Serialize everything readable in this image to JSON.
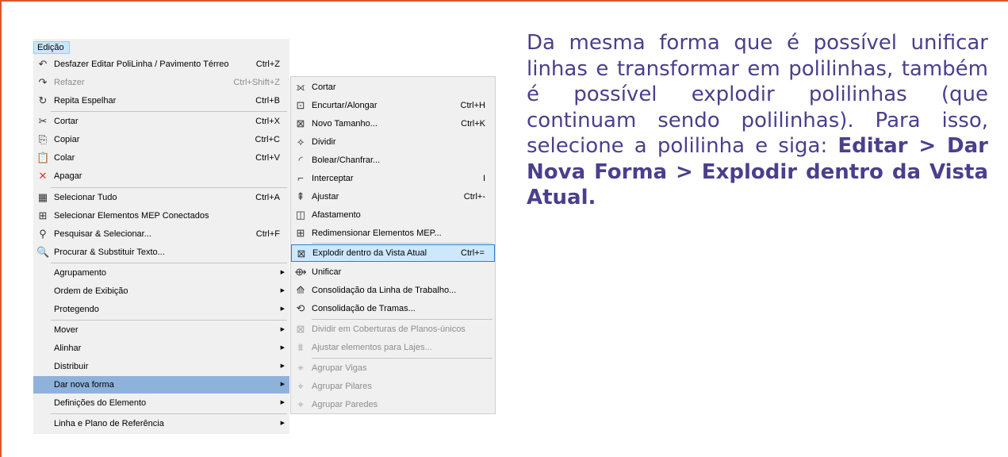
{
  "menu": {
    "title": "Edição",
    "items": [
      {
        "icon": "↶",
        "label": "Desfazer Editar PoliLinha / Pavimento Térreo",
        "shortcut": "Ctrl+Z"
      },
      {
        "icon": "↷",
        "label": "Refazer",
        "shortcut": "Ctrl+Shift+Z"
      },
      {
        "icon": "↻",
        "label": "Repita Espelhar",
        "shortcut": "Ctrl+B"
      },
      {
        "icon": "✂",
        "label": "Cortar",
        "shortcut": "Ctrl+X"
      },
      {
        "icon": "⎘",
        "label": "Copiar",
        "shortcut": "Ctrl+C"
      },
      {
        "icon": "📋",
        "label": "Colar",
        "shortcut": "Ctrl+V"
      },
      {
        "icon": "✕",
        "label": "Apagar",
        "shortcut": ""
      },
      {
        "icon": "▦",
        "label": "Selecionar Tudo",
        "shortcut": "Ctrl+A"
      },
      {
        "icon": "⊞",
        "label": "Selecionar Elementos MEP Conectados",
        "shortcut": ""
      },
      {
        "icon": "⚲",
        "label": "Pesquisar & Selecionar...",
        "shortcut": "Ctrl+F"
      },
      {
        "icon": "🔍",
        "label": "Procurar & Substituir Texto...",
        "shortcut": ""
      },
      {
        "label": "Agrupamento"
      },
      {
        "label": "Ordem de Exibição"
      },
      {
        "label": "Protegendo"
      },
      {
        "label": "Mover"
      },
      {
        "label": "Alinhar"
      },
      {
        "label": "Distribuir"
      },
      {
        "label": "Dar nova forma"
      },
      {
        "label": "Definições do Elemento"
      },
      {
        "label": "Linha e Plano de Referência"
      }
    ]
  },
  "submenu": {
    "items": [
      {
        "icon": "⟗",
        "label": "Cortar",
        "shortcut": ""
      },
      {
        "icon": "⊡",
        "label": "Encurtar/Alongar",
        "shortcut": "Ctrl+H"
      },
      {
        "icon": "⊠",
        "label": "Novo Tamanho...",
        "shortcut": "Ctrl+K"
      },
      {
        "icon": "⟡",
        "label": "Dividir",
        "shortcut": ""
      },
      {
        "icon": "◜",
        "label": "Bolear/Chanfrar...",
        "shortcut": ""
      },
      {
        "icon": "⌐",
        "label": "Interceptar",
        "shortcut": "I"
      },
      {
        "icon": "⇞",
        "label": "Ajustar",
        "shortcut": "Ctrl+-"
      },
      {
        "icon": "◫",
        "label": "Afastamento",
        "shortcut": ""
      },
      {
        "icon": "⊞",
        "label": "Redimensionar Elementos MEP...",
        "shortcut": ""
      },
      {
        "icon": "⊠",
        "label": "Explodir dentro da Vista Atual",
        "shortcut": "Ctrl+="
      },
      {
        "icon": "⟴",
        "label": "Unificar",
        "shortcut": ""
      },
      {
        "icon": "⟰",
        "label": "Consolidação da Linha de Trabalho...",
        "shortcut": ""
      },
      {
        "icon": "⟲",
        "label": "Consolidação de Tramas...",
        "shortcut": ""
      },
      {
        "icon": "⊠",
        "label": "Dividir em Coberturas de Planos-únicos",
        "shortcut": ""
      },
      {
        "icon": "⩩",
        "label": "Ajustar elementos para Lajes...",
        "shortcut": ""
      },
      {
        "icon": "⌖",
        "label": "Agrupar Vigas",
        "shortcut": ""
      },
      {
        "icon": "⌖",
        "label": "Agrupar Pilares",
        "shortcut": ""
      },
      {
        "icon": "⌖",
        "label": "Agrupar Paredes",
        "shortcut": ""
      }
    ]
  },
  "paragraph": {
    "text": "Da mesma forma que é possível unificar linhas e transformar em polilinhas, também é possível explodir polilinhas (que continuam sendo polilinhas). Para isso, selecione a polilinha e siga: ",
    "bold": "Editar > Dar Nova Forma > Explodir dentro da Vista Atual."
  }
}
